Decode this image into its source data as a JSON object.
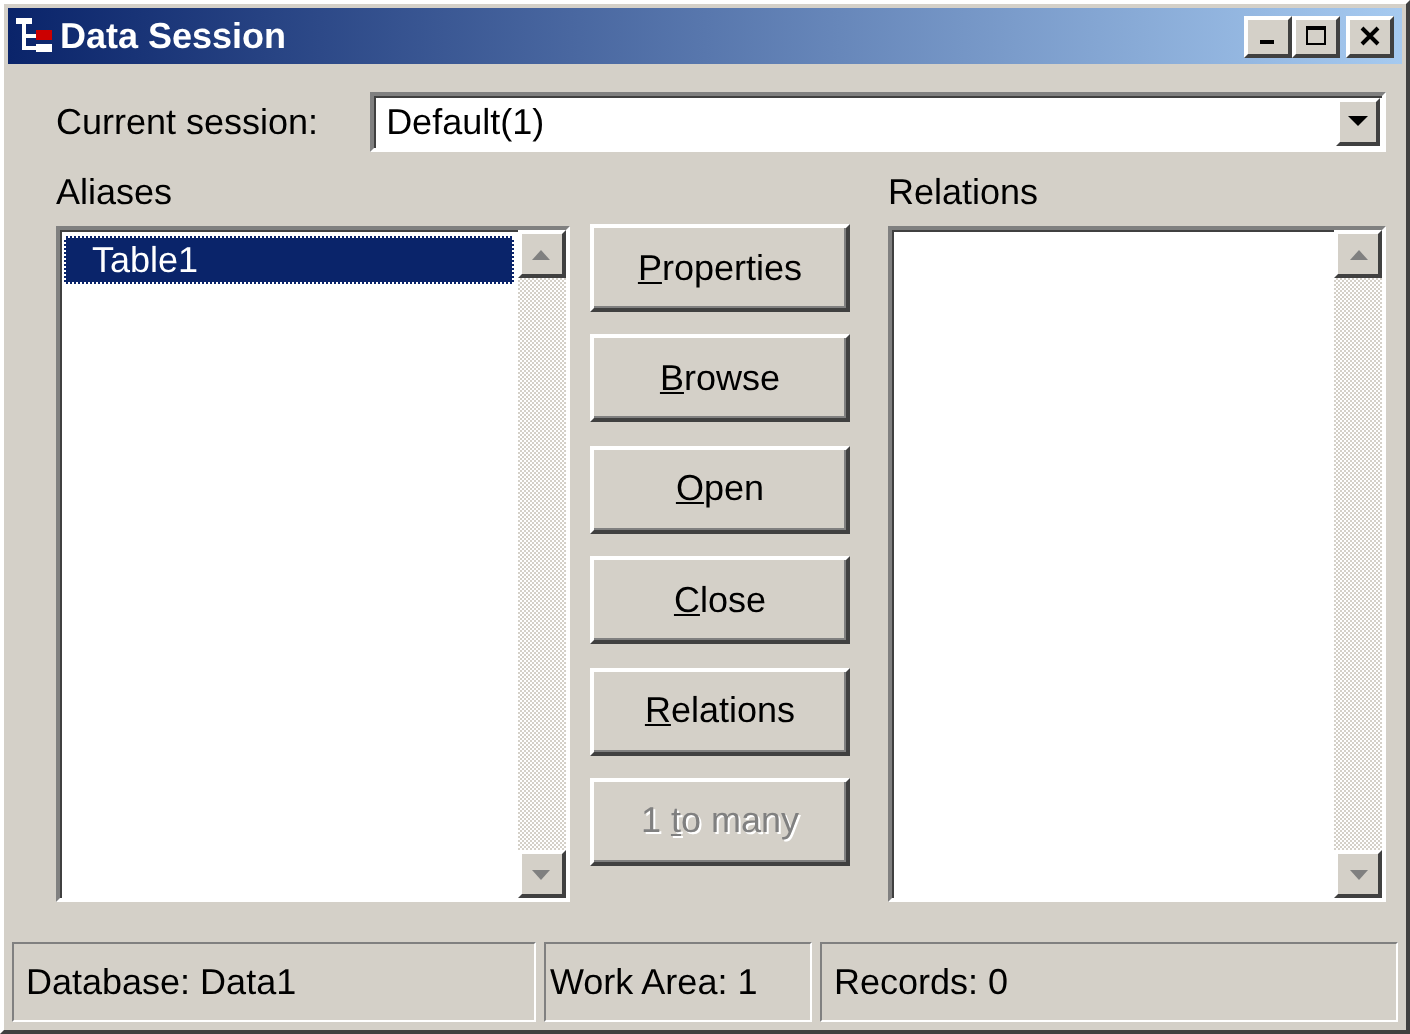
{
  "window": {
    "title": "Data Session"
  },
  "session": {
    "label": "Current session:",
    "value": "Default(1)"
  },
  "aliases": {
    "label": "Aliases",
    "items": [
      {
        "text": "Table1",
        "selected": true
      }
    ]
  },
  "buttons": [
    {
      "access_key": "P",
      "after": "roperties",
      "disabled": false
    },
    {
      "access_key": "B",
      "after": "rowse",
      "disabled": false
    },
    {
      "access_key": "O",
      "after": "pen",
      "disabled": false
    },
    {
      "access_key": "C",
      "after": "lose",
      "disabled": false
    },
    {
      "access_key": "R",
      "after": "elations",
      "disabled": false
    },
    {
      "before": "1 ",
      "access_key": "t",
      "after": "o many",
      "disabled": true
    }
  ],
  "relations": {
    "label": "Relations"
  },
  "status_bar": [
    "Database: Data1",
    "Work Area: 1",
    "Records: 0"
  ]
}
